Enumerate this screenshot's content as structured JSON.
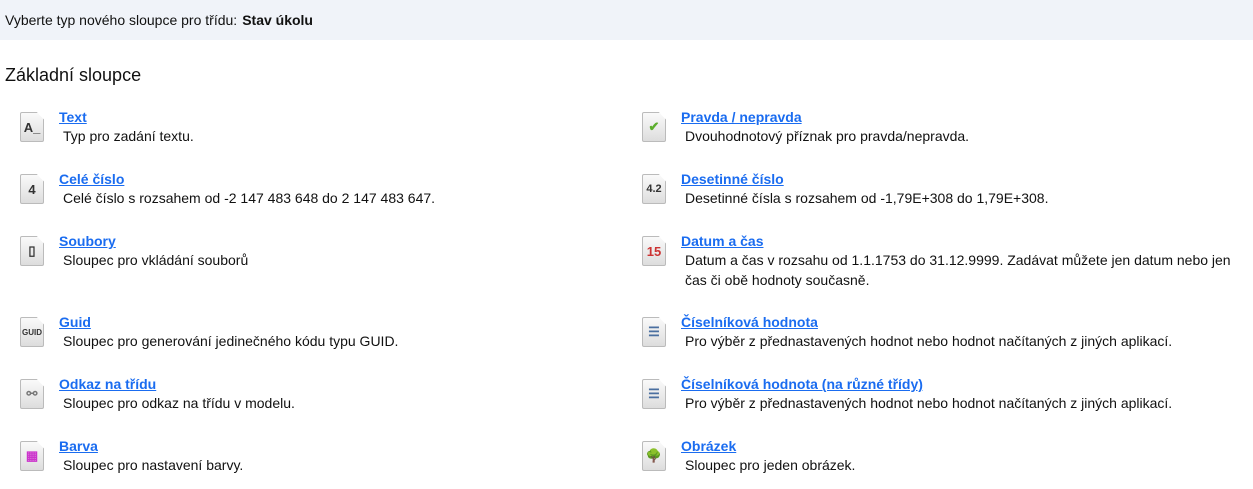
{
  "header": {
    "prompt": "Vyberte typ nového sloupce pro třídu:",
    "class_name": "Stav úkolu"
  },
  "section_title": "Základní sloupce",
  "items": [
    {
      "title": "Text",
      "desc": "Typ pro zadání textu.",
      "icon": "text-icon",
      "glyph": "A_"
    },
    {
      "title": "Pravda / nepravda",
      "desc": "Dvouhodnotový příznak pro pravda/nepravda.",
      "icon": "checkmark-icon",
      "glyph": "✔"
    },
    {
      "title": "Celé číslo",
      "desc": "Celé číslo s rozsahem od -2 147 483 648 do 2 147 483 647.",
      "icon": "integer-icon",
      "glyph": "4"
    },
    {
      "title": "Desetinné číslo",
      "desc": "Desetinné čísla s rozsahem od -1,79E+308 do 1,79E+308.",
      "icon": "decimal-icon",
      "glyph": "4.2"
    },
    {
      "title": "Soubory",
      "desc": "Sloupec pro vkládání souborů",
      "icon": "file-icon",
      "glyph": "▯"
    },
    {
      "title": "Datum a čas",
      "desc": "Datum a čas v rozsahu od 1.1.1753 do 31.12.9999. Zadávat můžete jen datum nebo jen čas či obě hodnoty současně.",
      "icon": "calendar-icon",
      "glyph": "15"
    },
    {
      "title": "Guid",
      "desc": "Sloupec pro generování jedinečného kódu typu GUID.",
      "icon": "guid-icon",
      "glyph": "GUID"
    },
    {
      "title": "Číselníková hodnota",
      "desc": "Pro výběr z přednastavených hodnot nebo hodnot načítaných z jiných aplikací.",
      "icon": "list-icon",
      "glyph": "☰"
    },
    {
      "title": "Odkaz na třídu",
      "desc": "Sloupec pro odkaz na třídu v modelu.",
      "icon": "link-icon",
      "glyph": "⚯"
    },
    {
      "title": "Číselníková hodnota (na různé třídy)",
      "desc": "Pro výběr z přednastavených hodnot nebo hodnot načítaných z jiných aplikací.",
      "icon": "list-icon",
      "glyph": "☰"
    },
    {
      "title": "Barva",
      "desc": "Sloupec pro nastavení barvy.",
      "icon": "color-icon",
      "glyph": "▦"
    },
    {
      "title": "Obrázek",
      "desc": "Sloupec pro jeden obrázek.",
      "icon": "image-icon",
      "glyph": "🌳"
    }
  ]
}
